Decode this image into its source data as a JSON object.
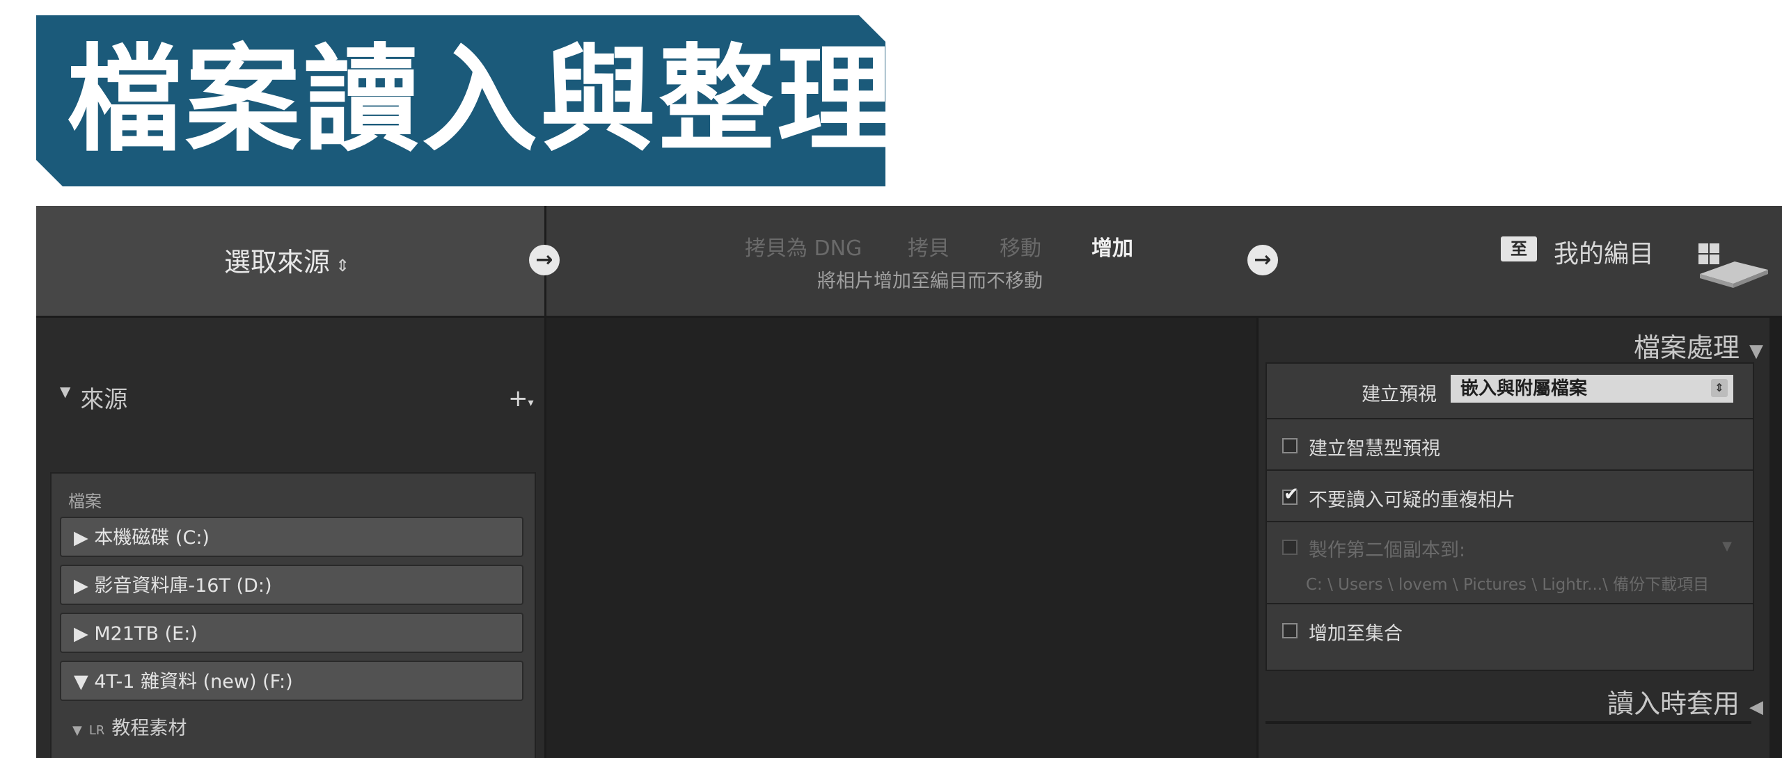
{
  "banner": {
    "title": "檔案讀入與整理"
  },
  "topbar": {
    "source_label": "選取來源",
    "source_arrows": "⇕",
    "modes": [
      "拷貝為 DNG",
      "拷貝",
      "移動",
      "增加"
    ],
    "active_mode": "增加",
    "mode_description": "將相片增加至編目而不移動",
    "to_badge": "至",
    "destination_label": "我的編目"
  },
  "left_panel": {
    "source_header": "來源",
    "files_title": "檔案",
    "drives": [
      "▶  本機磁碟 (C:)",
      "▶  影音資料庫-16T (D:)",
      "▶  M21TB (E:)",
      "▼  4T-1 雜資料 (new) (F:)"
    ],
    "folder_badge": "LR",
    "folder_name": "教程素材"
  },
  "right_panel": {
    "file_handling_header": "檔案處理",
    "build_previews_label": "建立預視",
    "build_previews_value": "嵌入與附屬檔案",
    "smart_previews_label": "建立智慧型預視",
    "dont_import_dupes_label": "不要讀入可疑的重複相片",
    "second_copy_label": "製作第二個副本到:",
    "second_copy_path": "C: \\ Users \\ lovem \\ Pictures \\ Lightr...\\ 備份下載項目",
    "add_to_collection_label": "增加至集合",
    "apply_during_import_header": "讀入時套用"
  },
  "colors": {
    "banner_bg": "#1b5a7a",
    "panel_bg": "#2b2b2b",
    "topbar_bg": "#3a3a3a"
  }
}
